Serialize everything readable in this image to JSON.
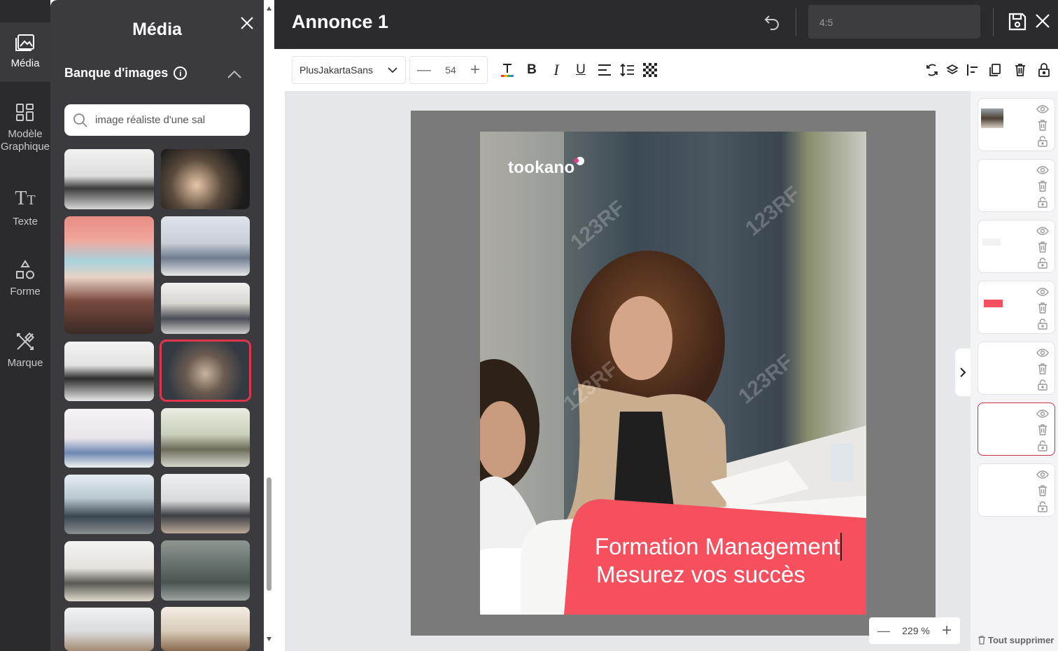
{
  "nav": {
    "items": [
      {
        "label": "Média",
        "icon": "image-gallery-icon"
      },
      {
        "label": "Modèle Graphique",
        "icon": "grid-template-icon"
      },
      {
        "label": "Texte",
        "icon": "text-icon"
      },
      {
        "label": "Forme",
        "icon": "shapes-icon"
      },
      {
        "label": "Marque",
        "icon": "brand-tools-icon"
      }
    ]
  },
  "panel": {
    "title": "Média",
    "bank_label": "Banque d'images",
    "search_value": "image réaliste d'une sal"
  },
  "header": {
    "title": "Annonce 1",
    "ratio": "4:5"
  },
  "toolbar": {
    "font": "PlusJakartaSans",
    "size": "54"
  },
  "canvas": {
    "brand": "tookano",
    "line1": "Formation Management",
    "line2": "Mesurez vos succès",
    "watermark": "123RF"
  },
  "zoom": {
    "value": "229 %"
  },
  "layers_panel": {
    "clear_all": "Tout supprimer"
  },
  "colors": {
    "accent": "#f6505f",
    "selection": "#e0364a",
    "dark": "#2b2b2e"
  }
}
